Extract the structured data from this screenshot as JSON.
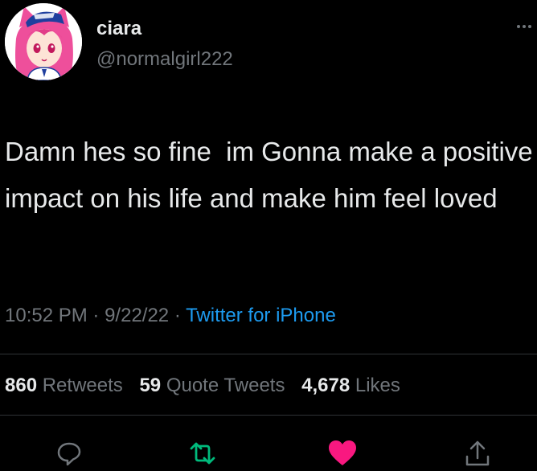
{
  "user": {
    "display_name": "ciara",
    "handle": "@normalgirl222",
    "avatar_icon": "anime-girl-avatar-icon"
  },
  "tweet": {
    "text": "Damn hes so fine  im Gonna make a positive impact on his life and make him feel loved",
    "time": "10:52 PM",
    "date": "9/22/22",
    "separator": "·",
    "source": "Twitter for iPhone"
  },
  "stats": {
    "retweets_count": "860",
    "retweets_label": "Retweets",
    "quotes_count": "59",
    "quotes_label": "Quote Tweets",
    "likes_count": "4,678",
    "likes_label": "Likes"
  },
  "actions": {
    "reply_icon": "reply-icon",
    "retweet_icon": "retweet-icon",
    "like_icon": "heart-icon",
    "share_icon": "share-icon",
    "more_icon": "more-icon",
    "retweet_color": "#00ba7c",
    "like_color": "#f91880"
  },
  "colors": {
    "background": "#000000",
    "text": "#e7e9ea",
    "muted": "#71767b",
    "link": "#1d9bf0"
  }
}
